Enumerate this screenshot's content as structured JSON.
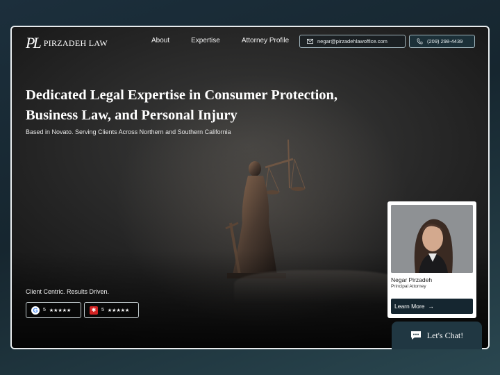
{
  "header": {
    "logo_mark": "PL",
    "logo_text": "PIRZADEH LAW",
    "nav": [
      "About",
      "Expertise",
      "Attorney Profile"
    ],
    "email": "negar@pirzadehlawoffice.com",
    "phone": "(209) 298-4439"
  },
  "hero": {
    "headline_line1": "Dedicated Legal Expertise in Consumer Protection,",
    "headline_line2": "Business Law, and Personal Injury",
    "subline": "Based in Novato. Serving Clients Across Northern and Southern California"
  },
  "reviews": {
    "tagline": "Client Centric. Results Driven.",
    "google_rating": "5",
    "google_stars": "★★★★★",
    "yelp_rating": "5",
    "yelp_stars": "★★★★★"
  },
  "attorney_card": {
    "name": "Negar Pirzadeh",
    "role": "Principal Attorney",
    "button_label": "Learn More"
  },
  "chat": {
    "label": "Let's Chat!"
  },
  "colors": {
    "accent_dark": "#152630",
    "frame_border": "#e8ecee"
  }
}
